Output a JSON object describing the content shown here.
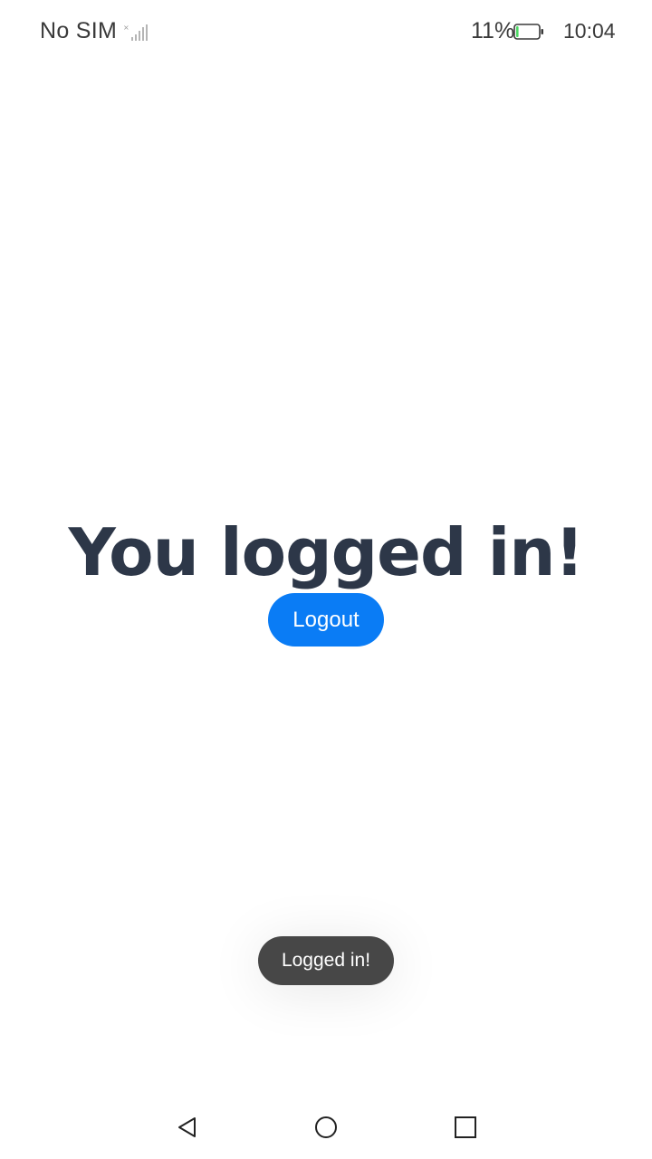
{
  "status_bar": {
    "carrier": "No SIM",
    "battery_percent": "11%",
    "battery_level": 0.11,
    "time": "10:04"
  },
  "main": {
    "headline": "You logged in!",
    "logout_label": "Logout"
  },
  "toast": {
    "message": "Logged in!"
  },
  "nav_bar": {
    "back_icon": "triangle-back-icon",
    "home_icon": "circle-home-icon",
    "recents_icon": "square-recents-icon"
  },
  "colors": {
    "accent": "#0a7cf5",
    "headline": "#2d3748",
    "toast_bg": "#474747",
    "battery_fill": "#4cd964"
  }
}
